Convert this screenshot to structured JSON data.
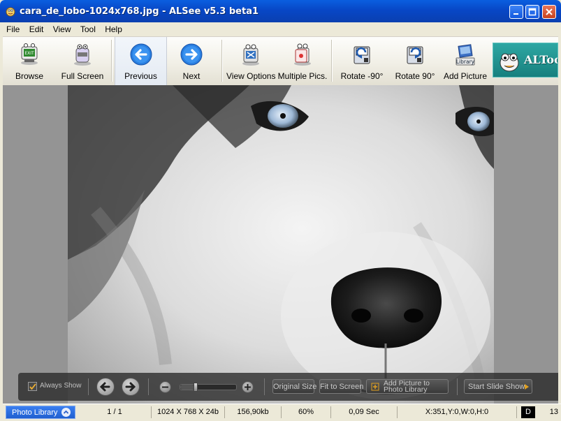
{
  "window": {
    "title": "cara_de_lobo-1024x768.jpg - ALSee v5.3 beta1"
  },
  "menu": [
    "File",
    "Edit",
    "View",
    "Tool",
    "Help"
  ],
  "toolbar": {
    "browse": "Browse",
    "full_screen": "Full Screen",
    "previous": "Previous",
    "next": "Next",
    "view_options": "View Options",
    "multiple_pics": "Multiple Pics.",
    "rotate_left": "Rotate -90°",
    "rotate_right": "Rotate 90°",
    "add_picture": "Add Picture",
    "add_picture_icon_text": "Library",
    "altools_logo": "ALTools"
  },
  "controls": {
    "always_show": "Always Show",
    "always_show_checked": true,
    "zoom_level": 0.25,
    "original_size": "Original Size",
    "fit_to_screen": "Fit to Screen",
    "add_to_library_line1": "Add Picture to",
    "add_to_library_line2": "Photo Library",
    "start_slide_show": "Start Slide Show"
  },
  "status": {
    "photo_library": "Photo Library",
    "index": "1 / 1",
    "dimensions": "1024 X 768 X 24b",
    "file_size": "156,90kb",
    "zoom": "60%",
    "load_time": "0,09 Sec",
    "coords": "X:351,Y:0,W:0,H:0",
    "d_indicator": "D",
    "extra": "13"
  },
  "colors": {
    "titlebar": "#0a54d6",
    "viewer_bg": "#949494",
    "control_bar": "#2a2a2a",
    "altools_bg": "#1f9693"
  }
}
